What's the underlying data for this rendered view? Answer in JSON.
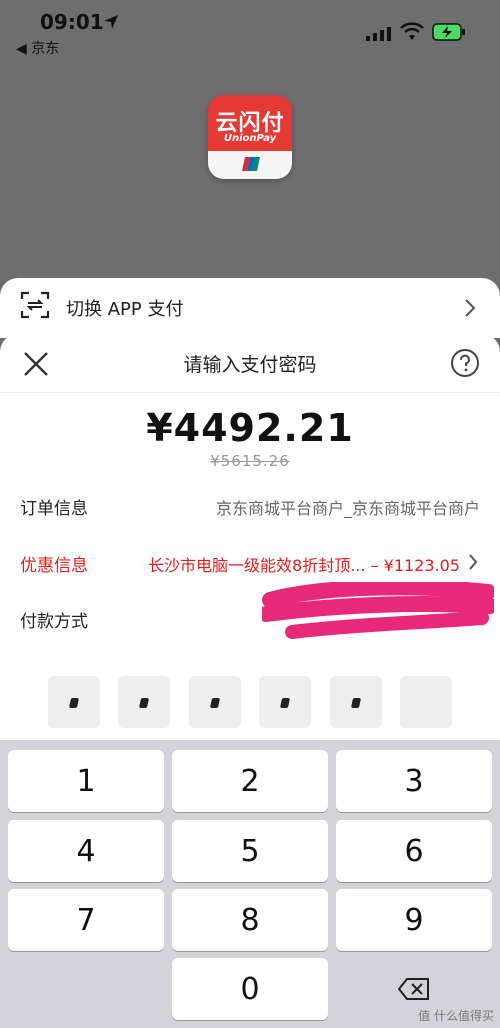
{
  "status_bar": {
    "time": "09:01",
    "back_app": "◀ 京东"
  },
  "switch_sheet": {
    "label": "切换 APP 支付"
  },
  "payment": {
    "title": "请输入支付密码",
    "amount": "¥4492.21",
    "original_price": "¥5615.26",
    "order_label": "订单信息",
    "order_value": "京东商城平台商户_京东商城平台商户",
    "promo_label": "优惠信息",
    "promo_value": "长沙市电脑一级能效8折封顶... – ¥1123.05",
    "method_label": "付款方式",
    "pin_length": 6,
    "pin_entered": 5
  },
  "keypad": {
    "keys": [
      "1",
      "2",
      "3",
      "4",
      "5",
      "6",
      "7",
      "8",
      "9",
      "0"
    ]
  },
  "watermark": "值 什么值得买",
  "colors": {
    "promo": "#e02020",
    "brand": "#e53935"
  }
}
